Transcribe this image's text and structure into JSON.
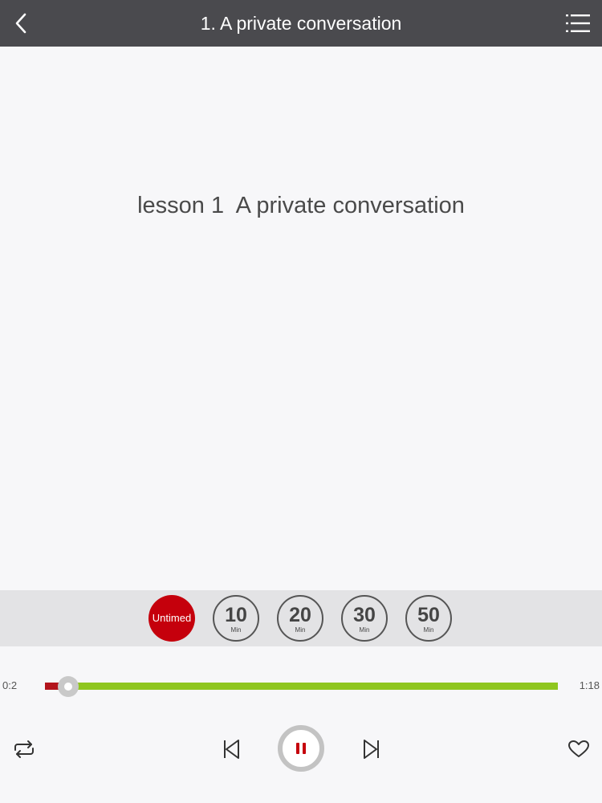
{
  "header": {
    "title": "1. A private conversation",
    "back_icon": "chevron-left-icon",
    "menu_icon": "list-icon"
  },
  "main": {
    "lesson_title": "lesson 1  A private conversation"
  },
  "timer": {
    "options": [
      {
        "label": "Untimed",
        "selected": true
      },
      {
        "value": "10",
        "unit": "Min",
        "selected": false
      },
      {
        "value": "20",
        "unit": "Min",
        "selected": false
      },
      {
        "value": "30",
        "unit": "Min",
        "selected": false
      },
      {
        "value": "50",
        "unit": "Min",
        "selected": false
      }
    ]
  },
  "player": {
    "current_time": "0:2",
    "total_time": "1:18",
    "progress_fraction": 0.045,
    "controls": {
      "repeat_icon": "repeat-icon",
      "previous_icon": "skip-previous-icon",
      "pause_icon": "pause-icon",
      "next_icon": "skip-next-icon",
      "favorite_icon": "heart-icon"
    }
  },
  "colors": {
    "header_bg": "#4a4a4e",
    "accent_red": "#c5000c",
    "progress_green": "#8fc61f"
  }
}
